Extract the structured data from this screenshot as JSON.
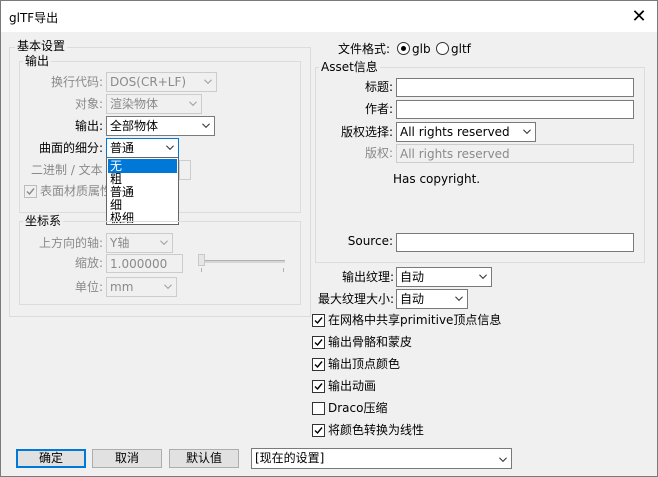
{
  "window": {
    "title": "glTF导出"
  },
  "basic": {
    "title": "基本设置",
    "output_group": {
      "title": "输出",
      "line_code_label": "换行代码:",
      "line_code_value": "DOS(CR+LF)",
      "target_label": "对象:",
      "target_value": "渲染物体",
      "output_label": "输出:",
      "output_value": "全部物体",
      "subdiv_label": "曲面的细分:",
      "subdiv_value": "普通",
      "subdiv_options": [
        "无",
        "粗",
        "普通",
        "细",
        "极细"
      ],
      "subdiv_selected": "无",
      "binary_label": "二进制 / 文本",
      "material_label": "表面材质属性"
    },
    "coord_group": {
      "title": "坐标系",
      "up_axis_label": "上方向的轴:",
      "up_axis_value": "Y轴",
      "scale_label": "缩放:",
      "scale_value": "1.000000",
      "unit_label": "单位:",
      "unit_value": "mm"
    }
  },
  "file_format": {
    "label": "文件格式:",
    "glb": "glb",
    "gltf": "gltf",
    "selected": "glb"
  },
  "asset": {
    "title": "Asset信息",
    "title_label": "标题:",
    "title_value": "",
    "author_label": "作者:",
    "author_value": "",
    "license_label": "版权选择:",
    "license_value": "All rights reserved",
    "copyright_label": "版权:",
    "copyright_value": "All rights reserved",
    "has_copyright": "Has copyright.",
    "source_label": "Source:",
    "source_value": ""
  },
  "texture": {
    "output_label": "输出纹理:",
    "output_value": "自动",
    "max_size_label": "最大纹理大小:",
    "max_size_value": "自动"
  },
  "checkboxes": [
    {
      "label": "在网格中共享primitive顶点信息",
      "checked": true
    },
    {
      "label": "输出骨骼和蒙皮",
      "checked": true
    },
    {
      "label": "输出顶点颜色",
      "checked": true
    },
    {
      "label": "输出动画",
      "checked": true
    },
    {
      "label": "Draco压缩",
      "checked": false
    },
    {
      "label": "将颜色转换为线性",
      "checked": true
    }
  ],
  "buttons": {
    "ok": "确定",
    "cancel": "取消",
    "default": "默认值"
  },
  "preset": {
    "value": "[现在的设置]"
  }
}
